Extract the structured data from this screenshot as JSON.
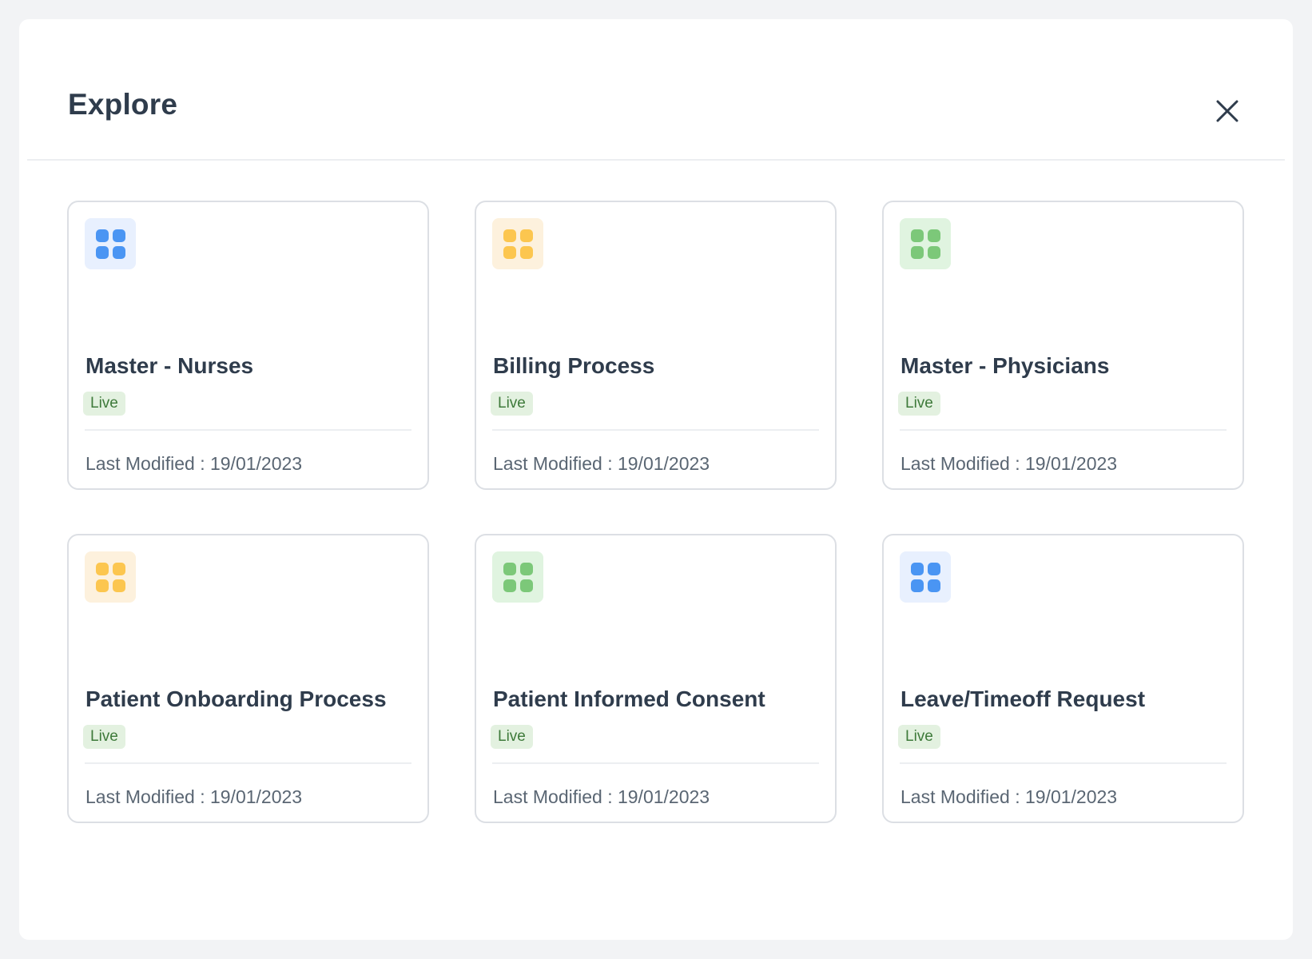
{
  "modal": {
    "title": "Explore",
    "close_icon": "close-icon"
  },
  "colors": {
    "blue_bg": "#e8f0fe",
    "blue_fg": "#4a95f3",
    "yellow_bg": "#fdf1dd",
    "yellow_fg": "#fcc64f",
    "green_bg": "#e0f4e0",
    "green_fg": "#7cc879",
    "live_bg": "#e3f1e0",
    "live_fg": "#3e7a3a"
  },
  "cards": [
    {
      "title": "Master - Nurses",
      "status": "Live",
      "modified": "Last Modified : 19/01/2023",
      "icon": "apps-grid-icon",
      "color": "blue"
    },
    {
      "title": "Billing Process",
      "status": "Live",
      "modified": "Last Modified : 19/01/2023",
      "icon": "apps-grid-icon",
      "color": "yellow"
    },
    {
      "title": "Master - Physicians",
      "status": "Live",
      "modified": "Last Modified : 19/01/2023",
      "icon": "apps-grid-icon",
      "color": "green"
    },
    {
      "title": "Patient Onboarding Process",
      "status": "Live",
      "modified": "Last Modified : 19/01/2023",
      "icon": "apps-grid-icon",
      "color": "yellow"
    },
    {
      "title": "Patient Informed Consent",
      "status": "Live",
      "modified": "Last Modified : 19/01/2023",
      "icon": "apps-grid-icon",
      "color": "green"
    },
    {
      "title": "Leave/Timeoff Request",
      "status": "Live",
      "modified": "Last Modified : 19/01/2023",
      "icon": "apps-grid-icon",
      "color": "blue"
    }
  ]
}
